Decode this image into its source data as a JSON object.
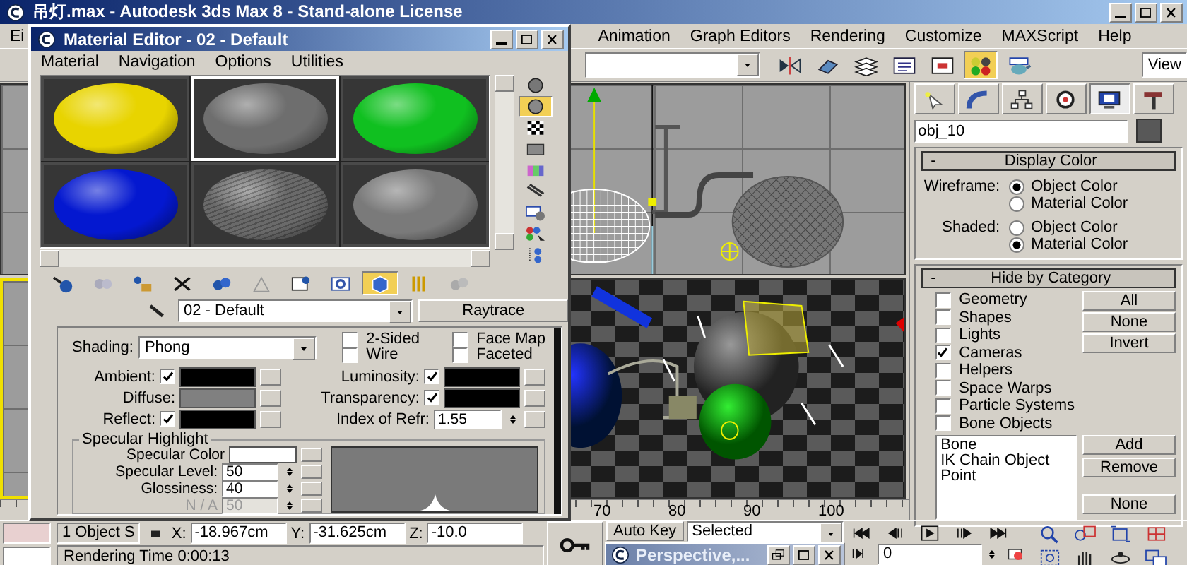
{
  "main_window": {
    "title": "吊灯.max - Autodesk 3ds Max 8  - Stand-alone License",
    "menu": [
      {
        "label": "Ei"
      },
      {
        "label": "Animation"
      },
      {
        "label": "Graph Editors"
      },
      {
        "label": "Rendering"
      },
      {
        "label": "Customize"
      },
      {
        "label": "MAXScript"
      },
      {
        "label": "Help"
      }
    ],
    "toolbar": [
      {
        "kind": "mirror",
        "on": false
      },
      {
        "kind": "align",
        "on": false
      },
      {
        "kind": "layers",
        "on": false
      },
      {
        "kind": "curve-editor",
        "on": false
      },
      {
        "kind": "schematic",
        "on": false
      },
      {
        "kind": "material-editor",
        "on": true
      },
      {
        "kind": "render",
        "on": false
      }
    ],
    "view_dropdown": "View"
  },
  "command_panel": {
    "tabs": [
      {
        "kind": "create",
        "selected": false
      },
      {
        "kind": "modify",
        "selected": false
      },
      {
        "kind": "hierarchy",
        "selected": false
      },
      {
        "kind": "motion",
        "selected": false
      },
      {
        "kind": "display",
        "selected": true
      },
      {
        "kind": "utilities",
        "selected": false
      }
    ],
    "object_name": "obj_10",
    "display_color": {
      "toggle": "-",
      "title": "Display Color",
      "groups": [
        {
          "label": "Wireframe:",
          "options": [
            {
              "label": "Object Color",
              "selected": true
            },
            {
              "label": "Material Color",
              "selected": false
            }
          ]
        },
        {
          "label": "Shaded:",
          "options": [
            {
              "label": "Object Color",
              "selected": false
            },
            {
              "label": "Material Color",
              "selected": true
            }
          ]
        }
      ]
    },
    "hide_by_category": {
      "toggle": "-",
      "title": "Hide by Category",
      "categories": [
        {
          "label": "Geometry",
          "checked": false
        },
        {
          "label": "Shapes",
          "checked": false
        },
        {
          "label": "Lights",
          "checked": false
        },
        {
          "label": "Cameras",
          "checked": true
        },
        {
          "label": "Helpers",
          "checked": false
        },
        {
          "label": "Space Warps",
          "checked": false
        },
        {
          "label": "Particle Systems",
          "checked": false
        },
        {
          "label": "Bone Objects",
          "checked": false
        }
      ],
      "buttons": [
        "All",
        "None",
        "Invert"
      ],
      "list": [
        "Bone",
        "IK Chain Object",
        "Point"
      ],
      "list_buttons": [
        "Add",
        "Remove",
        "None"
      ]
    }
  },
  "timeline": {
    "ticks": [
      "70",
      "80",
      "90",
      "100"
    ]
  },
  "status_bar": {
    "selection": "1 Object S",
    "coords": [
      {
        "axis": "X:",
        "value": "-18.967cm"
      },
      {
        "axis": "Y:",
        "value": "-31.625cm"
      },
      {
        "axis": "Z:",
        "value": "-10.0"
      }
    ],
    "prompt": "Rendering Time  0:00:13"
  },
  "animation_controls": {
    "auto_key": "Auto Key",
    "key_filter": "Selected",
    "frame": "0"
  },
  "minimized_window": {
    "title": "Perspective,..."
  },
  "material_editor": {
    "title": "Material Editor - 02 - Default",
    "menu": [
      "Material",
      "Navigation",
      "Options",
      "Utilities"
    ],
    "slots": [
      {
        "color": "#e8d400",
        "kind": "smooth",
        "selected": false
      },
      {
        "color": "#6e6e6e",
        "kind": "smooth",
        "selected": true
      },
      {
        "color": "#10c020",
        "kind": "smooth",
        "selected": false
      },
      {
        "color": "#0418d0",
        "kind": "smooth",
        "selected": false
      },
      {
        "color": "#6a6a6a",
        "kind": "mesh",
        "selected": false
      },
      {
        "color": "#7a7a7a",
        "kind": "smooth",
        "selected": false
      }
    ],
    "side_tools": [
      {
        "kind": "sample-type",
        "on": false
      },
      {
        "kind": "backlight",
        "on": true
      },
      {
        "kind": "background",
        "on": false
      },
      {
        "kind": "uv-tiling",
        "on": false
      },
      {
        "kind": "video-check",
        "on": false
      },
      {
        "kind": "preview",
        "on": false
      },
      {
        "kind": "options",
        "on": false
      },
      {
        "kind": "select-by-material",
        "on": false
      },
      {
        "kind": "navigator",
        "on": false
      }
    ],
    "tools": [
      {
        "kind": "get-material",
        "on": false
      },
      {
        "kind": "put-to-scene",
        "on": false
      },
      {
        "kind": "assign",
        "on": false
      },
      {
        "kind": "reset",
        "on": false
      },
      {
        "kind": "make-unique",
        "on": false
      },
      {
        "kind": "put-to-library",
        "on": false
      },
      {
        "kind": "material-id",
        "on": false
      },
      {
        "kind": "show-map",
        "on": false
      },
      {
        "kind": "show-end-result",
        "on": true
      },
      {
        "kind": "go-parent",
        "on": false
      },
      {
        "kind": "go-sibling",
        "on": false
      }
    ],
    "material_name": "02 - Default",
    "material_type": "Raytrace",
    "shading": {
      "label": "Shading:",
      "value": "Phong"
    },
    "flags": [
      {
        "label": "2-Sided",
        "checked": false
      },
      {
        "label": "Wire",
        "checked": false
      },
      {
        "label": "Face Map",
        "checked": false
      },
      {
        "label": "Faceted",
        "checked": false
      }
    ],
    "colors": [
      {
        "label": "Ambient:",
        "kind": "checkbox",
        "checked": true,
        "color": "#000000"
      },
      {
        "label": "Diffuse:",
        "kind": "plain",
        "color": "#808080"
      },
      {
        "label": "Reflect:",
        "kind": "checkbox",
        "checked": true,
        "color": "#000000"
      },
      {
        "label": "Luminosity:",
        "kind": "checkbox",
        "checked": true,
        "color": "#000000"
      },
      {
        "label": "Transparency:",
        "kind": "checkbox",
        "checked": true,
        "color": "#000000"
      }
    ],
    "refraction": {
      "label": "Index of Refr:",
      "value": "1.55"
    },
    "specular": {
      "title": "Specular Highlight",
      "color_label": "Specular Color",
      "color": "#ffffff",
      "spinners": [
        {
          "label": "Specular Level:",
          "value": "50",
          "disabled": false
        },
        {
          "label": "Glossiness:",
          "value": "40",
          "disabled": false
        },
        {
          "label": "N / A",
          "value": "50",
          "disabled": true
        }
      ]
    }
  }
}
